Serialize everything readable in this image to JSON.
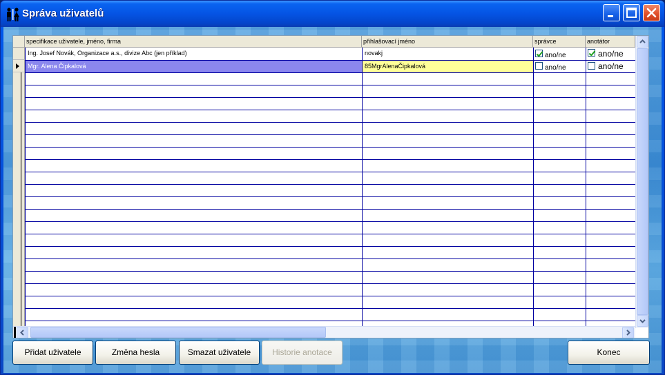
{
  "window": {
    "title": "Správa uživatelů",
    "accent": "#0554e4"
  },
  "grid": {
    "columns": [
      {
        "id": "spec",
        "label": "specifikace uživatele, jméno, firma"
      },
      {
        "id": "login",
        "label": "přihlašovací jméno"
      },
      {
        "id": "admin",
        "label": "správce"
      },
      {
        "id": "annot",
        "label": "anotátor"
      }
    ],
    "rows": [
      {
        "spec": "Ing. Josef Novák, Organizace a.s., divize Abc (jen příklad)",
        "login": "novakj",
        "admin": true,
        "admin_label": "ano/ne",
        "annot": true,
        "annot_label": "ano/ne"
      },
      {
        "spec": "Mgr. Alena Čipkalová",
        "login": "85MgrAlenaČipkalová",
        "admin": false,
        "admin_label": "ano/ne",
        "annot": false,
        "annot_label": "ano/ne"
      }
    ],
    "selected_color": "#8b87ee",
    "edit_color": "#ffff99"
  },
  "buttons": {
    "add_user": "Přidat uživatele",
    "change_password": "Změna hesla",
    "delete_user": "Smazat uživatele",
    "annotation_history": "Historie anotace",
    "close": "Konec"
  }
}
